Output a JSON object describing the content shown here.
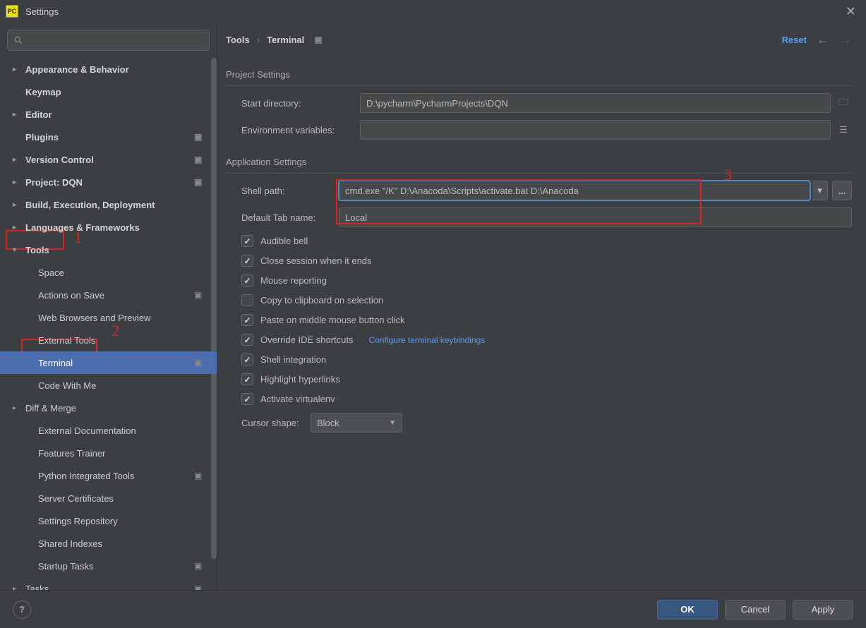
{
  "window": {
    "title": "Settings",
    "app_icon_text": "PC"
  },
  "sidebar": {
    "items": [
      {
        "label": "Appearance & Behavior",
        "level": 0,
        "arrow": "right",
        "badge": false
      },
      {
        "label": "Keymap",
        "level": 0,
        "arrow": "none",
        "badge": false
      },
      {
        "label": "Editor",
        "level": 0,
        "arrow": "right",
        "badge": false
      },
      {
        "label": "Plugins",
        "level": 0,
        "arrow": "none",
        "badge": true
      },
      {
        "label": "Version Control",
        "level": 0,
        "arrow": "right",
        "badge": true
      },
      {
        "label": "Project: DQN",
        "level": 0,
        "arrow": "right",
        "badge": true
      },
      {
        "label": "Build, Execution, Deployment",
        "level": 0,
        "arrow": "right",
        "badge": false
      },
      {
        "label": "Languages & Frameworks",
        "level": 0,
        "arrow": "right",
        "badge": false
      },
      {
        "label": "Tools",
        "level": 0,
        "arrow": "down",
        "badge": false
      },
      {
        "label": "Space",
        "level": 1,
        "arrow": "none",
        "badge": false
      },
      {
        "label": "Actions on Save",
        "level": 1,
        "arrow": "none",
        "badge": true
      },
      {
        "label": "Web Browsers and Preview",
        "level": 1,
        "arrow": "none",
        "badge": false
      },
      {
        "label": "External Tools",
        "level": 1,
        "arrow": "none",
        "badge": false
      },
      {
        "label": "Terminal",
        "level": 1,
        "arrow": "none",
        "badge": true,
        "selected": true
      },
      {
        "label": "Code With Me",
        "level": 1,
        "arrow": "none",
        "badge": false
      },
      {
        "label": "Diff & Merge",
        "level": 1,
        "arrow": "right",
        "badge": false
      },
      {
        "label": "External Documentation",
        "level": 1,
        "arrow": "none",
        "badge": false
      },
      {
        "label": "Features Trainer",
        "level": 1,
        "arrow": "none",
        "badge": false
      },
      {
        "label": "Python Integrated Tools",
        "level": 1,
        "arrow": "none",
        "badge": true
      },
      {
        "label": "Server Certificates",
        "level": 1,
        "arrow": "none",
        "badge": false
      },
      {
        "label": "Settings Repository",
        "level": 1,
        "arrow": "none",
        "badge": false
      },
      {
        "label": "Shared Indexes",
        "level": 1,
        "arrow": "none",
        "badge": false
      },
      {
        "label": "Startup Tasks",
        "level": 1,
        "arrow": "none",
        "badge": true
      },
      {
        "label": "Tasks",
        "level": 1,
        "arrow": "right",
        "badge": true
      }
    ]
  },
  "breadcrumb": {
    "root": "Tools",
    "sep": "›",
    "leaf": "Terminal"
  },
  "header": {
    "reset": "Reset"
  },
  "sections": {
    "project": "Project Settings",
    "application": "Application Settings"
  },
  "fields": {
    "start_dir_label": "Start directory:",
    "start_dir_value": "D:\\pycharm\\PycharmProjects\\DQN",
    "env_label": "Environment variables:",
    "env_value": "",
    "shell_label": "Shell path:",
    "shell_value": "cmd.exe \"/K\" D:\\Anacoda\\Scripts\\activate.bat D:\\Anacoda",
    "tabname_label": "Default Tab name:",
    "tabname_value": "Local",
    "cursor_label": "Cursor shape:",
    "cursor_value": "Block"
  },
  "checks": {
    "audible": {
      "label": "Audible bell",
      "checked": true
    },
    "close_session": {
      "label": "Close session when it ends",
      "checked": true
    },
    "mouse": {
      "label": "Mouse reporting",
      "checked": true
    },
    "clipboard": {
      "label": "Copy to clipboard on selection",
      "checked": false
    },
    "paste": {
      "label": "Paste on middle mouse button click",
      "checked": true
    },
    "override": {
      "label": "Override IDE shortcuts",
      "checked": true
    },
    "shellint": {
      "label": "Shell integration",
      "checked": true
    },
    "highlight": {
      "label": "Highlight hyperlinks",
      "checked": true
    },
    "venv": {
      "label": "Activate virtualenv",
      "checked": true
    }
  },
  "links": {
    "keybindings": "Configure terminal keybindings"
  },
  "annotations": {
    "a1": "1",
    "a2": "2",
    "a3": "3"
  },
  "footer": {
    "help": "?",
    "ok": "OK",
    "cancel": "Cancel",
    "apply": "Apply"
  },
  "misc": {
    "browse": "..."
  }
}
